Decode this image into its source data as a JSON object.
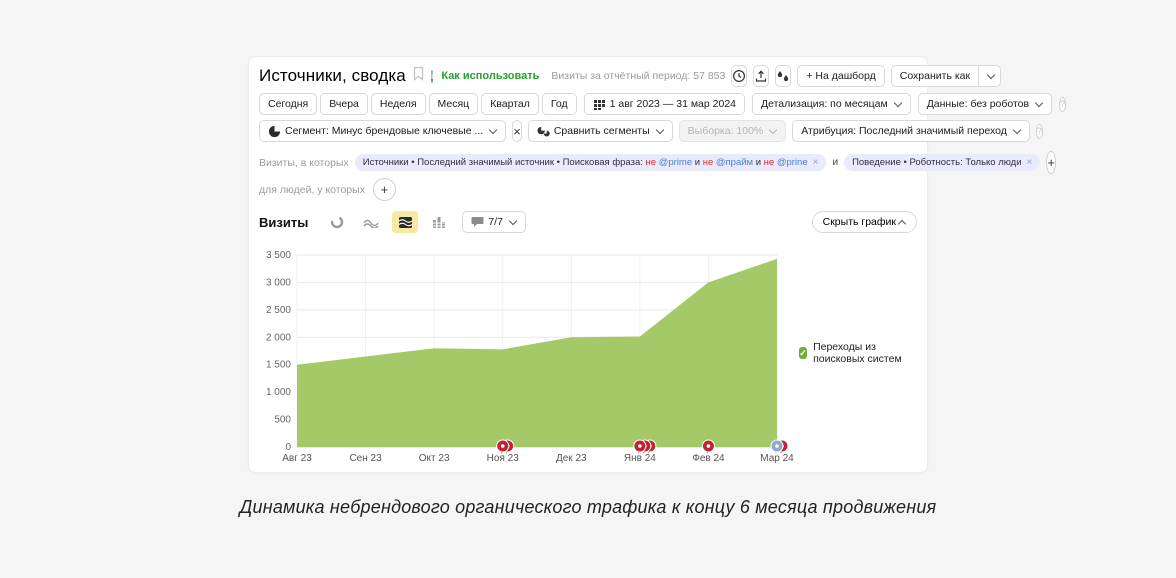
{
  "header": {
    "title": "Источники, сводка",
    "how_to_use_label": "Как использовать",
    "visits_summary": "Визиты за отчётный период: 57 853",
    "to_dashboard_label": "+ На дашборд",
    "save_as_label": "Сохранить как"
  },
  "toolbar": {
    "period_tabs": [
      "Сегодня",
      "Вчера",
      "Неделя",
      "Месяц",
      "Квартал",
      "Год"
    ],
    "date_range": "1 авг 2023 — 31 мар 2024",
    "detail_label": "Детализация: по месяцам",
    "data_label": "Данные: без роботов"
  },
  "segment_bar": {
    "segment_label": "Сегмент: Минус брендовые ключевые ...",
    "compare_label": "Сравнить сегменты",
    "sampling_label": "Выборка: 100%",
    "attribution_label": "Атрибуция: Последний значимый переход"
  },
  "filters": {
    "visits_in_which": "Визиты, в которых",
    "source_chip_parts": [
      {
        "text": "Источники • Последний значимый источник • Поисковая фраза: ",
        "color": "default"
      },
      {
        "text": "не ",
        "color": "red"
      },
      {
        "text": "@prime",
        "color": "blue"
      },
      {
        "text": " и ",
        "color": "default"
      },
      {
        "text": "не ",
        "color": "red"
      },
      {
        "text": "@прайм",
        "color": "blue"
      },
      {
        "text": " и ",
        "color": "default"
      },
      {
        "text": "не ",
        "color": "red"
      },
      {
        "text": "@prine",
        "color": "blue"
      }
    ],
    "and_label": "и",
    "behavior_chip": "Поведение • Роботность: Только люди",
    "for_people": "для людей, у которых"
  },
  "chart_controls": {
    "metric_label": "Визиты",
    "comments_label": "7/7",
    "hide_chart_label": "Скрыть график"
  },
  "chart_data": {
    "type": "area",
    "title": "Визиты",
    "categories": [
      "Авг 23",
      "Сен 23",
      "Окт 23",
      "Ноя 23",
      "Дек 23",
      "Янв 24",
      "Фев 24",
      "Мар 24"
    ],
    "series": [
      {
        "name": "Переходы из поисковых систем",
        "values": [
          1500,
          1650,
          1800,
          1780,
          2000,
          2015,
          3000,
          3430
        ],
        "color": "#a4c968"
      }
    ],
    "xlabel": "",
    "ylabel": "",
    "ylim": [
      0,
      3500
    ],
    "ytick_step": 500,
    "ytick_labels": [
      "0",
      "500",
      "1 000",
      "1 500",
      "2 000",
      "2 500",
      "3 000",
      "3 500"
    ],
    "grid": true,
    "legend_position": "right",
    "legend_color": "#6fae3a",
    "annotations": [
      {
        "index": 3,
        "pins": [
          "red",
          "red"
        ]
      },
      {
        "index": 5,
        "pins": [
          "red",
          "red",
          "red"
        ]
      },
      {
        "index": 6,
        "pins": [
          "red"
        ]
      },
      {
        "index": 7,
        "pins": [
          "blue",
          "red"
        ]
      }
    ],
    "pin_colors": {
      "red": "#bf2433",
      "blue": "#8fa9d0"
    }
  },
  "caption": "Динамика небрендового органического трафика к концу 6 месяца продвижения",
  "colors": {
    "page_bg": "#f5f5f6",
    "accent_green": "#27a12e",
    "selected_icon_bg": "#f8e9a1",
    "chip_bg": "#e9eafb",
    "area_green": "#a4c968"
  }
}
